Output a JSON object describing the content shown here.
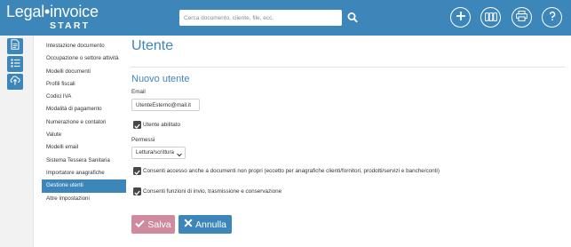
{
  "header": {
    "logo_name": "Legal•invoice",
    "logo_sub": "START",
    "search_placeholder": "Cerca documento, cliente, file, ecc."
  },
  "icons": {
    "search": "search-icon",
    "top_actions": [
      "plus-icon",
      "counter-icon",
      "printer-icon",
      "help-icon"
    ],
    "rail": [
      "documents-icon",
      "list-icon",
      "cloud-upload-icon"
    ]
  },
  "sidebar": {
    "items": [
      {
        "label": "Intestazione documento"
      },
      {
        "label": "Occupazione o settore attività"
      },
      {
        "label": "Modelli documenti"
      },
      {
        "label": "Profili fiscali"
      },
      {
        "label": "Codici IVA"
      },
      {
        "label": "Modalità di pagamento"
      },
      {
        "label": "Numerazione e contatori"
      },
      {
        "label": "Valute"
      },
      {
        "label": "Modelli email"
      },
      {
        "label": "Sistema Tessera Sanitaria"
      },
      {
        "label": "Importatore anagrafiche"
      },
      {
        "label": "Gestione utenti"
      },
      {
        "label": "Altre impostazioni"
      }
    ],
    "active_index": 11
  },
  "main": {
    "title": "Utente",
    "section_title": "Nuovo utente",
    "email_label": "Email",
    "email_value": "UtenteEsterno@mail.it",
    "enabled_label": "Utente abilitato",
    "enabled_checked": true,
    "permissions_label": "Permessi",
    "permissions_value": "Lettura/scrittura",
    "access_label": "Consenti accesso anche a documenti non propri (eccetto per anagrafiche clienti/fornitori, prodotti/servizi e banche/conti)",
    "access_checked": true,
    "send_label": "Consenti funzioni di invio, trasmissione e conservazione",
    "send_checked": true
  },
  "actions": {
    "save_label": "Salva",
    "cancel_label": "Annulla"
  },
  "colors": {
    "primary": "#3d86b9",
    "save_disabled": "#cf8b9d",
    "checkbox": "#474747"
  }
}
